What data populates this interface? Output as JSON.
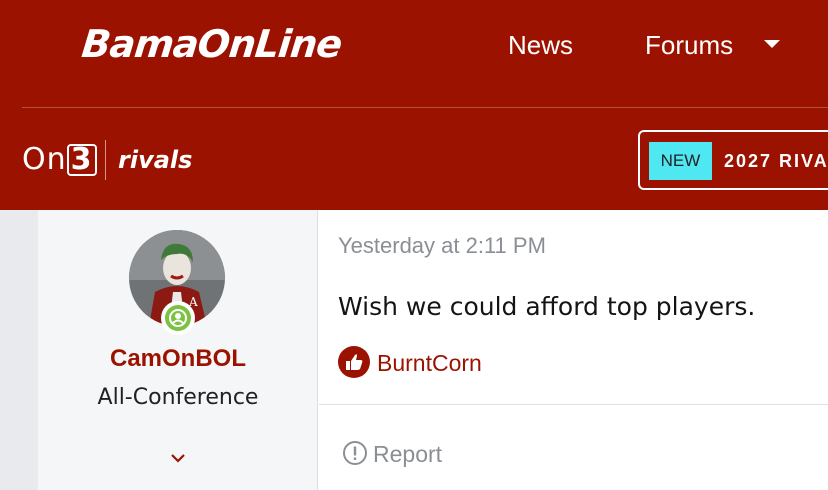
{
  "header": {
    "logo_text": "BamaOnLine",
    "nav": {
      "news_label": "News",
      "forums_label": "Forums"
    },
    "brands": {
      "on3_prefix": "On",
      "on3_suffix": "3",
      "rivals": "rivals"
    },
    "promo": {
      "badge": "NEW",
      "text": "2027 RIVA"
    }
  },
  "post": {
    "author": {
      "username": "CamOnBOL",
      "title": "All-Conference"
    },
    "timestamp": "Yesterday at 2:11 PM",
    "message": "Wish we could afford top players.",
    "reaction": {
      "user": "BurntCorn"
    },
    "actions": {
      "report_label": "Report"
    }
  },
  "colors": {
    "brand": "#9b1300",
    "promo_badge": "#4ee7f2",
    "online": "#7cc142",
    "muted_text": "#8a8f96"
  }
}
